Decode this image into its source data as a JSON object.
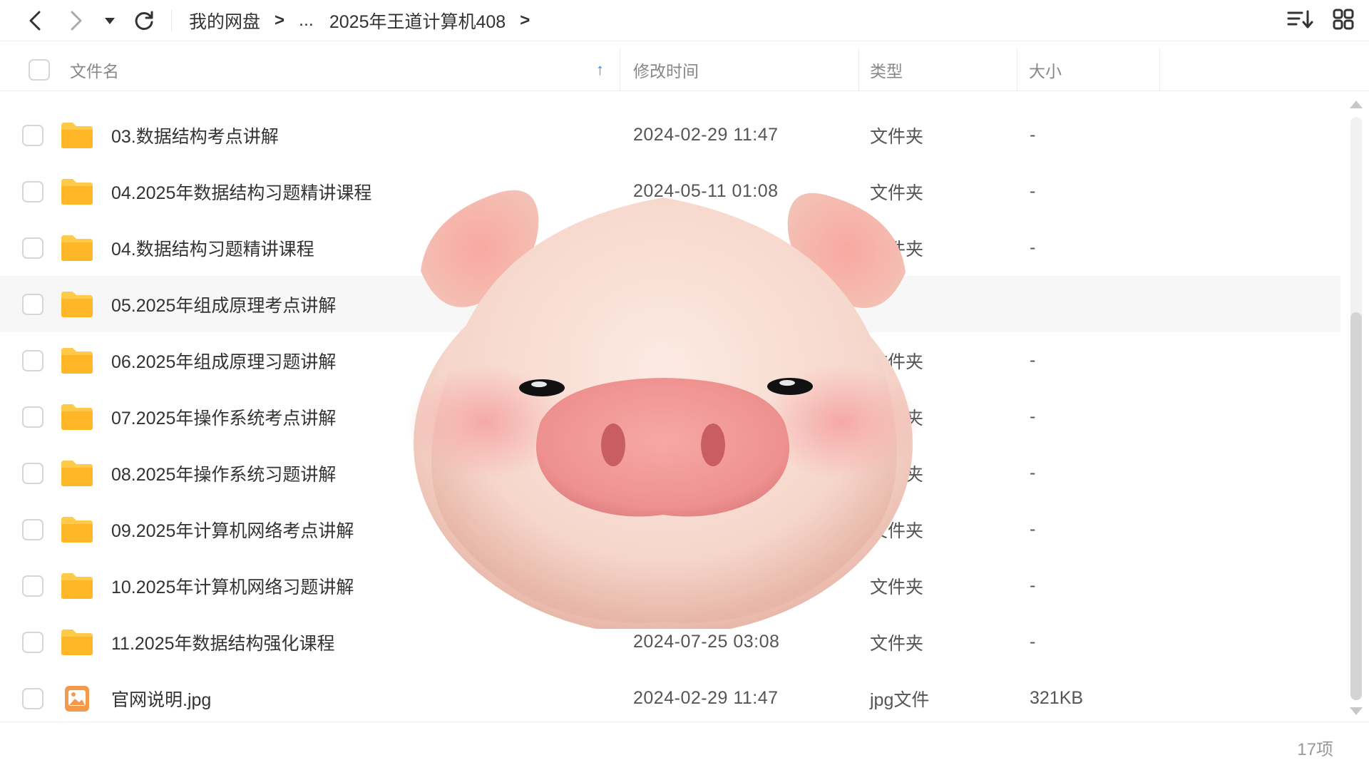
{
  "toolbar": {
    "back_icon": "chevron-left-icon",
    "forward_icon": "chevron-right-icon",
    "history_icon": "caret-down-icon",
    "refresh_icon": "refresh-icon",
    "sort_icon": "sort-list-icon",
    "view_icon": "grid-view-icon"
  },
  "breadcrumb": {
    "root": "我的网盘",
    "ellipsis": "...",
    "current": "2025年王道计算机408",
    "sep": ">"
  },
  "header": {
    "name": "文件名",
    "modified": "修改时间",
    "type": "类型",
    "size": "大小",
    "sort_indicator": "↑"
  },
  "rows": [
    {
      "name": "03.数据结构考点讲解",
      "time": "2024-02-29 11:47",
      "type": "文件夹",
      "size": "-",
      "kind": "folder"
    },
    {
      "name": "04.2025年数据结构习题精讲课程",
      "time": "2024-05-11 01:08",
      "type": "文件夹",
      "size": "-",
      "kind": "folder"
    },
    {
      "name": "04.数据结构习题精讲课程",
      "time": "",
      "type": "文件夹",
      "size": "-",
      "kind": "folder"
    },
    {
      "name": "05.2025年组成原理考点讲解",
      "time": "",
      "type": "",
      "size": "",
      "kind": "folder"
    },
    {
      "name": "06.2025年组成原理习题讲解",
      "time": "",
      "type": "文件夹",
      "size": "-",
      "kind": "folder"
    },
    {
      "name": "07.2025年操作系统考点讲解",
      "time": "",
      "type": "文件夹",
      "size": "-",
      "kind": "folder"
    },
    {
      "name": "08.2025年操作系统习题讲解",
      "time": "",
      "type": "文件夹",
      "size": "-",
      "kind": "folder"
    },
    {
      "name": "09.2025年计算机网络考点讲解",
      "time": "",
      "type": "文件夹",
      "size": "-",
      "kind": "folder"
    },
    {
      "name": "10.2025年计算机网络习题讲解",
      "time": "",
      "type": "文件夹",
      "size": "-",
      "kind": "folder"
    },
    {
      "name": "11.2025年数据结构强化课程",
      "time": "2024-07-25 03:08",
      "type": "文件夹",
      "size": "-",
      "kind": "folder"
    },
    {
      "name": "官网说明.jpg",
      "time": "2024-02-29 11:47",
      "type": "jpg文件",
      "size": "321KB",
      "kind": "image"
    }
  ],
  "footer": {
    "count": "17项"
  },
  "colors": {
    "folder": "#FFC94A",
    "image_icon": "#F39A4A",
    "sort_indicator": "#2D8CF0"
  }
}
